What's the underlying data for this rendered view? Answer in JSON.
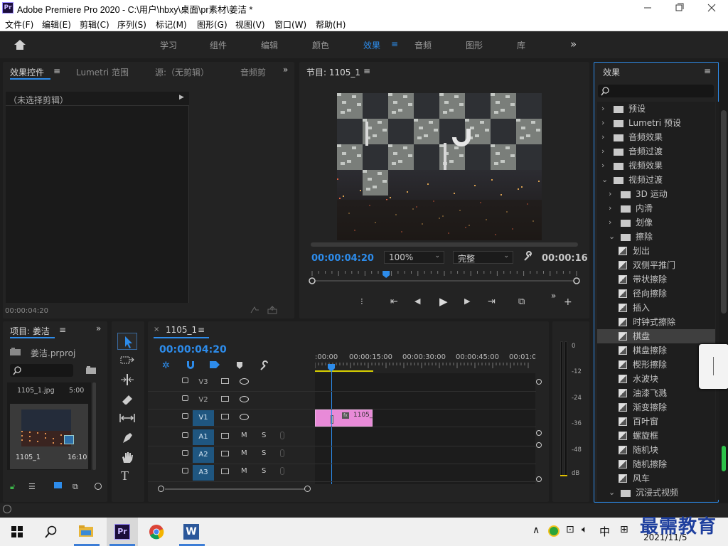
{
  "window": {
    "title": "Adobe Premiere Pro 2020 - C:\\用户\\hbxy\\桌面\\pr素材\\姜洁 *",
    "app_icon": "Pr"
  },
  "menu": [
    "文件(F)",
    "编辑(E)",
    "剪辑(C)",
    "序列(S)",
    "标记(M)",
    "图形(G)",
    "视图(V)",
    "窗口(W)",
    "帮助(H)"
  ],
  "workspaces": {
    "items": [
      "学习",
      "组件",
      "编辑",
      "颜色",
      "效果",
      "音频",
      "图形",
      "库"
    ],
    "active": "效果"
  },
  "source_panel": {
    "tabs": [
      "效果控件",
      "Lumetri 范围",
      "源:（无剪辑）",
      "音频剪"
    ],
    "no_clip": "（未选择剪辑）",
    "timecode": "00:00:04:20"
  },
  "program": {
    "title": "节目: 1105_1",
    "timecode_in": "00:00:04:20",
    "zoom": "100%",
    "quality": "完整",
    "timecode_out": "00:00:16",
    "playhead_fraction": 0.28
  },
  "effects": {
    "title": "效果",
    "search_placeholder": "",
    "tree": [
      {
        "label": "预设",
        "depth": 0,
        "type": "special",
        "exp": false
      },
      {
        "label": "Lumetri 预设",
        "depth": 0,
        "type": "special",
        "exp": false
      },
      {
        "label": "音频效果",
        "depth": 0,
        "type": "folder",
        "exp": false
      },
      {
        "label": "音频过渡",
        "depth": 0,
        "type": "folder",
        "exp": false
      },
      {
        "label": "视频效果",
        "depth": 0,
        "type": "folder",
        "exp": false
      },
      {
        "label": "视频过渡",
        "depth": 0,
        "type": "folder",
        "exp": true
      },
      {
        "label": "3D 运动",
        "depth": 1,
        "type": "folder",
        "exp": false
      },
      {
        "label": "内滑",
        "depth": 1,
        "type": "folder",
        "exp": false
      },
      {
        "label": "划像",
        "depth": 1,
        "type": "folder",
        "exp": false
      },
      {
        "label": "擦除",
        "depth": 1,
        "type": "folder",
        "exp": true
      },
      {
        "label": "划出",
        "depth": 2,
        "type": "effect"
      },
      {
        "label": "双侧平推门",
        "depth": 2,
        "type": "effect"
      },
      {
        "label": "带状擦除",
        "depth": 2,
        "type": "effect"
      },
      {
        "label": "径向擦除",
        "depth": 2,
        "type": "effect"
      },
      {
        "label": "插入",
        "depth": 2,
        "type": "effect"
      },
      {
        "label": "时钟式擦除",
        "depth": 2,
        "type": "effect"
      },
      {
        "label": "棋盘",
        "depth": 2,
        "type": "effect",
        "selected": true
      },
      {
        "label": "棋盘擦除",
        "depth": 2,
        "type": "effect"
      },
      {
        "label": "楔形擦除",
        "depth": 2,
        "type": "effect"
      },
      {
        "label": "水波块",
        "depth": 2,
        "type": "effect"
      },
      {
        "label": "油漆飞溅",
        "depth": 2,
        "type": "effect"
      },
      {
        "label": "渐变擦除",
        "depth": 2,
        "type": "effect"
      },
      {
        "label": "百叶窗",
        "depth": 2,
        "type": "effect"
      },
      {
        "label": "螺旋框",
        "depth": 2,
        "type": "effect"
      },
      {
        "label": "随机块",
        "depth": 2,
        "type": "effect"
      },
      {
        "label": "随机擦除",
        "depth": 2,
        "type": "effect"
      },
      {
        "label": "风车",
        "depth": 2,
        "type": "effect"
      },
      {
        "label": "沉浸式视频",
        "depth": 1,
        "type": "folder",
        "exp": true
      }
    ]
  },
  "project": {
    "title": "项目: 姜洁",
    "file": "姜洁.prproj",
    "item_top_name": "1105_1.jpg",
    "item_top_dur": "5:00",
    "item_name": "1105_1",
    "item_dur": "16:10"
  },
  "timeline": {
    "tab": "1105_1",
    "timecode": "00:00:04:20",
    "ruler": [
      ":00:00",
      "00:00:15:00",
      "00:00:30:00",
      "00:00:45:00",
      "00:01:0"
    ],
    "video_tracks": [
      "V3",
      "V2",
      "V1"
    ],
    "audio_tracks": [
      "A1",
      "A2",
      "A3"
    ],
    "clip_label": "1105_",
    "mute": "M",
    "solo": "S"
  },
  "meter": {
    "scale": [
      "0",
      "-12",
      "-24",
      "-36",
      "-48",
      "dB"
    ]
  },
  "taskbar": {
    "ime": "中",
    "time": "",
    "date": "2021/11/5"
  },
  "watermark": "最需教育",
  "colors": {
    "accent": "#2d8ceb",
    "clip": "#e88ad8",
    "track_btn": "#1f5680",
    "selected_row": "#3f3f3f"
  }
}
